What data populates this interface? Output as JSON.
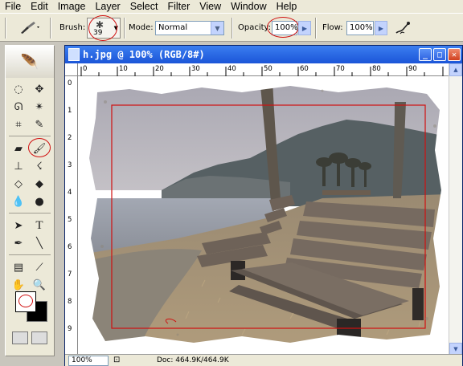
{
  "menu": [
    "File",
    "Edit",
    "Image",
    "Layer",
    "Select",
    "Filter",
    "View",
    "Window",
    "Help"
  ],
  "options": {
    "brush_label": "Brush:",
    "brush_size": "39",
    "mode_label": "Mode:",
    "mode_value": "Normal",
    "opacity_label": "Opacity:",
    "opacity_value": "100%",
    "flow_label": "Flow:",
    "flow_value": "100%"
  },
  "document": {
    "title": "h.jpg @ 100% (RGB/8#)",
    "zoom": "100%",
    "doc_size": "Doc: 464.9K/464.9K"
  },
  "ruler": {
    "h_ticks": [
      "0",
      "10",
      "20",
      "30",
      "40",
      "50",
      "60",
      "70",
      "80",
      "90"
    ],
    "v_ticks": [
      "0",
      "1",
      "2",
      "3",
      "4",
      "5",
      "6",
      "7",
      "8",
      "9"
    ]
  },
  "colors": {
    "annotation_red": "#d01010",
    "title_blue": "#1b55d8",
    "panel": "#ece9d8"
  },
  "icons": {
    "window_buttons": [
      "minimize-icon",
      "maximize-icon",
      "close-icon"
    ]
  }
}
